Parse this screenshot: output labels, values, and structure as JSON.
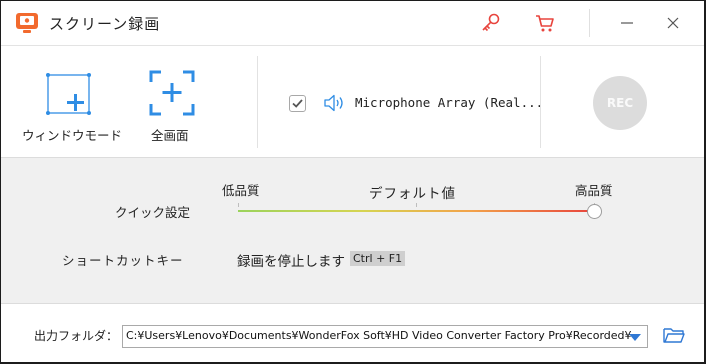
{
  "title": "スクリーン録画",
  "modes": [
    {
      "label": "ウィンドウモード"
    },
    {
      "label": "全画面"
    }
  ],
  "audio": {
    "checked": true,
    "device": "Microphone Array (Real..."
  },
  "rec_label": "REC",
  "quality": {
    "label": "クイック設定",
    "low": "低品質",
    "default": "デフォルト値",
    "high": "高品質",
    "level": 1.0
  },
  "shortcut": {
    "label": "ショートカットキー",
    "action": "録画を停止します",
    "key": "Ctrl + F1"
  },
  "output": {
    "label": "出力フォルダ：",
    "path": "C:¥Users¥Lenovo¥Documents¥WonderFox Soft¥HD Video Converter Factory Pro¥Recorded¥"
  },
  "colors": {
    "accent": "#e8443d",
    "blue": "#2f78d4"
  },
  "icons": [
    "key-icon",
    "cart-icon",
    "minimize-icon",
    "close-icon",
    "window-mode-icon",
    "fullscreen-icon",
    "speaker-icon",
    "folder-icon"
  ]
}
